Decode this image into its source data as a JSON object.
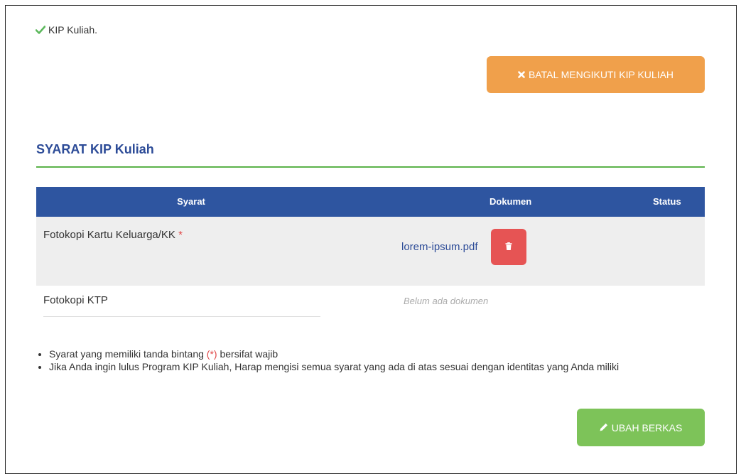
{
  "kip_status": {
    "label": "KIP Kuliah."
  },
  "actions": {
    "cancel_label": "BATAL MENGIKUTI KIP KULIAH",
    "edit_label": "UBAH BERKAS"
  },
  "section": {
    "title": "SYARAT KIP Kuliah"
  },
  "table": {
    "headers": {
      "syarat": "Syarat",
      "dokumen": "Dokumen",
      "status": "Status"
    },
    "rows": [
      {
        "syarat": "Fotokopi Kartu Keluarga/KK",
        "required_mark": "*",
        "dokumen": "lorem-ipsum.pdf"
      },
      {
        "syarat": "Fotokopi KTP",
        "dokumen_empty": "Belum ada dokumen"
      }
    ]
  },
  "notes": {
    "item1_prefix": "Syarat yang memiliki tanda bintang ",
    "item1_mark": "(*)",
    "item1_suffix": " bersifat wajib",
    "item2": "Jika Anda ingin lulus Program KIP Kuliah, Harap mengisi semua syarat yang ada di atas sesuai dengan identitas yang Anda miliki"
  },
  "colors": {
    "primary_blue": "#2e55a0",
    "success_green": "#7dc359",
    "warning_orange": "#f0a04b",
    "danger_red": "#e65454"
  },
  "icons": {
    "status": "check-icon",
    "cancel": "times-icon",
    "delete": "trash-icon",
    "edit": "pencil-icon"
  }
}
